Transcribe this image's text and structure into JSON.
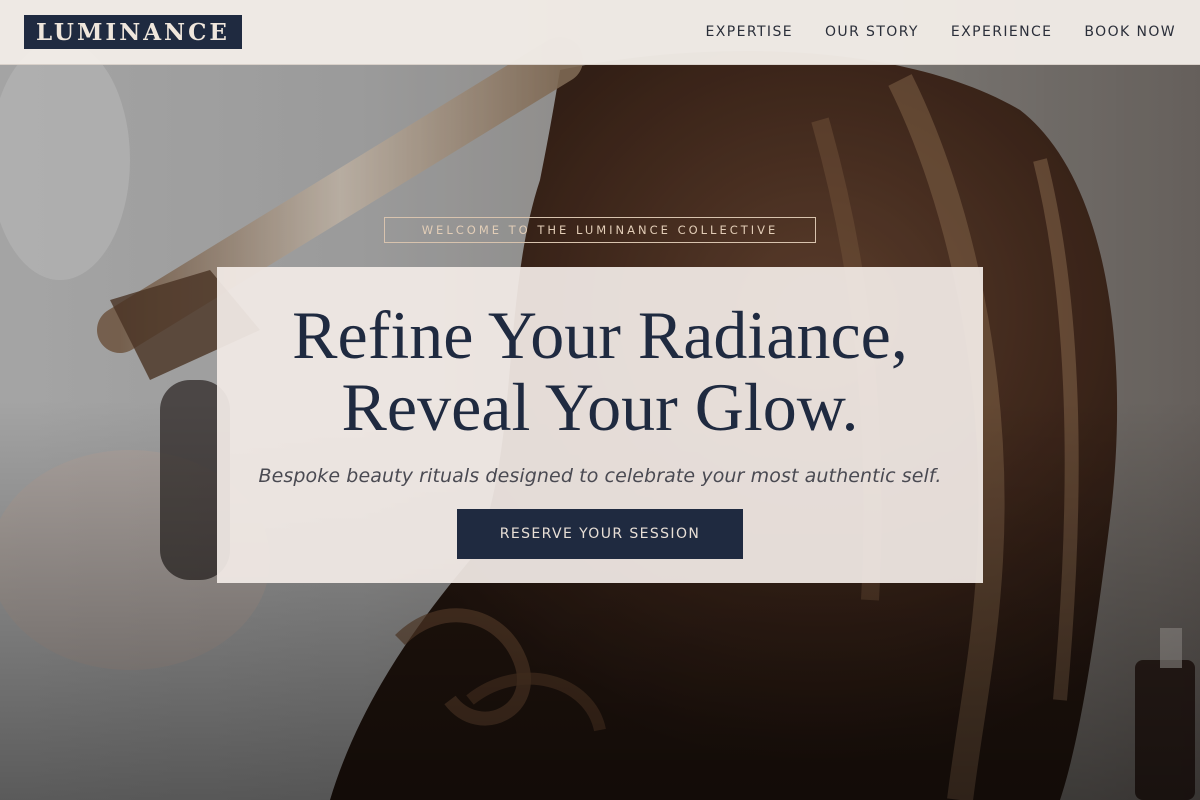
{
  "header": {
    "logo": "LUMINANCE",
    "nav": [
      {
        "label": "EXPERTISE"
      },
      {
        "label": "OUR STORY"
      },
      {
        "label": "EXPERIENCE"
      },
      {
        "label": "BOOK NOW"
      }
    ]
  },
  "hero": {
    "eyebrow": "WELCOME TO THE LUMINANCE COLLECTIVE",
    "title_line1": "Refine Your Radiance,",
    "title_line2": "Reveal Your Glow.",
    "subtitle": "Bespoke beauty rituals designed to celebrate your most authentic self.",
    "cta": "RESERVE YOUR SESSION"
  },
  "colors": {
    "navy": "#1f2a40",
    "cream": "#f2ebe6",
    "accent_gold": "#d8c3ae"
  }
}
